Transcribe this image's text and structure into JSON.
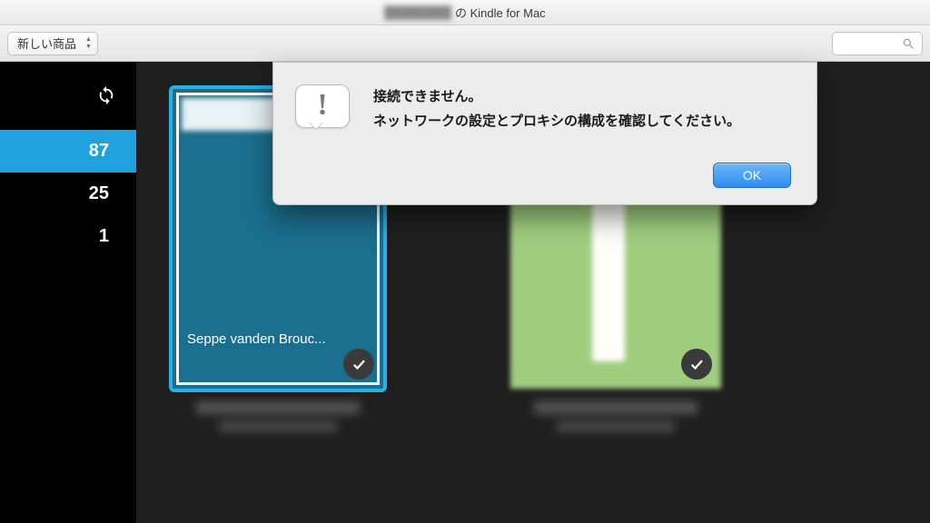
{
  "titlebar": {
    "suffix": "の Kindle for Mac"
  },
  "toolbar": {
    "dropdown_label": "新しい商品",
    "search_placeholder": ""
  },
  "sidebar": {
    "items": [
      {
        "count": "87",
        "active": true
      },
      {
        "count": "25",
        "active": false
      },
      {
        "count": "1",
        "active": false
      }
    ]
  },
  "library": {
    "books": [
      {
        "author_line": "Seppe vanden Brouc...",
        "selected": true,
        "downloaded": true
      },
      {
        "author_line": "",
        "selected": false,
        "downloaded": true
      }
    ]
  },
  "dialog": {
    "title": "接続できません。",
    "message": "ネットワークの設定とプロキシの構成を確認してください。",
    "ok_label": "OK"
  }
}
